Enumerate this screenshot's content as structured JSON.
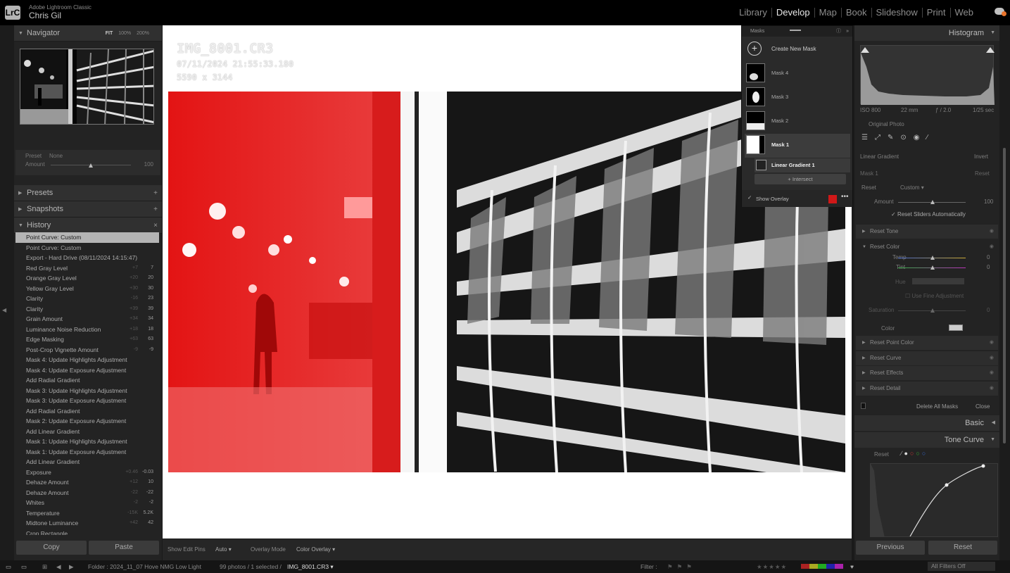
{
  "app": {
    "logo": "LrC",
    "name": "Adobe Lightroom Classic",
    "user": "Chris Gil"
  },
  "modules": [
    {
      "label": "Library",
      "active": false
    },
    {
      "label": "Develop",
      "active": true
    },
    {
      "label": "Map",
      "active": false
    },
    {
      "label": "Book",
      "active": false
    },
    {
      "label": "Slideshow",
      "active": false
    },
    {
      "label": "Print",
      "active": false
    },
    {
      "label": "Web",
      "active": false
    }
  ],
  "left": {
    "navigator": {
      "title": "Navigator",
      "zoom_fit": "FIT",
      "zoom_100": "100%",
      "zoom_200": "200%"
    },
    "preset": {
      "label": "Preset",
      "value": "None",
      "amount_label": "Amount",
      "amount_value": "100"
    },
    "presets_title": "Presets",
    "snapshots_title": "Snapshots",
    "history_title": "History",
    "history": [
      {
        "label": "Point Curve: Custom",
        "selected": true,
        "d": "",
        "v": ""
      },
      {
        "label": "Point Curve: Custom",
        "d": "",
        "v": ""
      },
      {
        "label": "Export - Hard Drive (08/11/2024 14:15:47)",
        "d": "",
        "v": ""
      },
      {
        "label": "Red Gray Level",
        "d": "+7",
        "v": "7"
      },
      {
        "label": "Orange Gray Level",
        "d": "+20",
        "v": "20"
      },
      {
        "label": "Yellow Gray Level",
        "d": "+30",
        "v": "30"
      },
      {
        "label": "Clarity",
        "d": "-16",
        "v": "23"
      },
      {
        "label": "Clarity",
        "d": "+39",
        "v": "39"
      },
      {
        "label": "Grain Amount",
        "d": "+34",
        "v": "34"
      },
      {
        "label": "Luminance Noise Reduction",
        "d": "+18",
        "v": "18"
      },
      {
        "label": "Edge Masking",
        "d": "+63",
        "v": "63"
      },
      {
        "label": "Post-Crop Vignette Amount",
        "d": "-9",
        "v": "-9"
      },
      {
        "label": "Mask 4: Update Highlights Adjustment",
        "d": "",
        "v": ""
      },
      {
        "label": "Mask 4: Update Exposure Adjustment",
        "d": "",
        "v": ""
      },
      {
        "label": "Add Radial Gradient",
        "d": "",
        "v": ""
      },
      {
        "label": "Mask 3: Update Highlights Adjustment",
        "d": "",
        "v": ""
      },
      {
        "label": "Mask 3: Update Exposure Adjustment",
        "d": "",
        "v": ""
      },
      {
        "label": "Add Radial Gradient",
        "d": "",
        "v": ""
      },
      {
        "label": "Mask 2: Update Exposure Adjustment",
        "d": "",
        "v": ""
      },
      {
        "label": "Add Linear Gradient",
        "d": "",
        "v": ""
      },
      {
        "label": "Mask 1: Update Highlights Adjustment",
        "d": "",
        "v": ""
      },
      {
        "label": "Mask 1: Update Exposure Adjustment",
        "d": "",
        "v": ""
      },
      {
        "label": "Add Linear Gradient",
        "d": "",
        "v": ""
      },
      {
        "label": "Exposure",
        "d": "+0.46",
        "v": "-0.03"
      },
      {
        "label": "Dehaze Amount",
        "d": "+12",
        "v": "10"
      },
      {
        "label": "Dehaze Amount",
        "d": "-22",
        "v": "-22"
      },
      {
        "label": "Whites",
        "d": "-2",
        "v": "-2"
      },
      {
        "label": "Temperature",
        "d": "-15K",
        "v": "5.2K"
      },
      {
        "label": "Midtone Luminance",
        "d": "+42",
        "v": "42"
      },
      {
        "label": "Crop Rectangle",
        "d": "",
        "v": ""
      }
    ],
    "copy": "Copy",
    "paste": "Paste"
  },
  "image_info": {
    "filename": "IMG_8001.CR3",
    "datetime": "07/11/2024 21:55:33.180",
    "dimensions": "5590 x 3144"
  },
  "masks": {
    "title": "Masks",
    "create": "Create New Mask",
    "items": [
      "Mask 4",
      "Mask 3",
      "Mask 2",
      "Mask 1"
    ],
    "component": "Linear Gradient 1",
    "intersect": "Intersect",
    "show_overlay": "Show Overlay",
    "overlay_color": "#d01818"
  },
  "toolbar": {
    "show_edit_pins": "Show Edit Pins",
    "pins_value": "Auto",
    "overlay_mode": "Overlay Mode",
    "overlay_value": "Color Overlay"
  },
  "status": {
    "folder": "Folder : 2024_11_07 Hove NMG Low Light",
    "count": "99 photos / 1 selected /",
    "file": "IMG_8001.CR3",
    "filter": "Filter :",
    "filters_off": "All Filters Off"
  },
  "right": {
    "histogram": {
      "title": "Histogram",
      "iso": "ISO 800",
      "focal": "22 mm",
      "aperture": "ƒ / 2.0",
      "shutter": "1/25 sec",
      "original": "Original Photo"
    },
    "mask_edit": {
      "type": "Linear Gradient",
      "invert": "Invert",
      "mask_name": "Mask 1",
      "reset": "Reset",
      "reset_label": "Reset",
      "preset": "Custom",
      "amount_label": "Amount",
      "amount_value": "100",
      "reset_auto": "Reset Sliders Automatically"
    },
    "sections": {
      "tone": "Reset Tone",
      "color": "Reset Color",
      "temp": "Temp",
      "tint": "Tint",
      "temp_v": "0",
      "tint_v": "0",
      "hue": "Hue",
      "fine": "Use Fine Adjustment",
      "saturation": "Saturation",
      "sat_v": "0",
      "color_label": "Color",
      "point_color": "Reset Point Color",
      "curve": "Reset Curve",
      "effects": "Reset Effects",
      "detail": "Reset Detail",
      "delete_all": "Delete All Masks",
      "close": "Close"
    },
    "basic": "Basic",
    "tone_curve": "Tone Curve",
    "tc_reset": "Reset",
    "previous": "Previous",
    "reset_btn": "Reset"
  }
}
